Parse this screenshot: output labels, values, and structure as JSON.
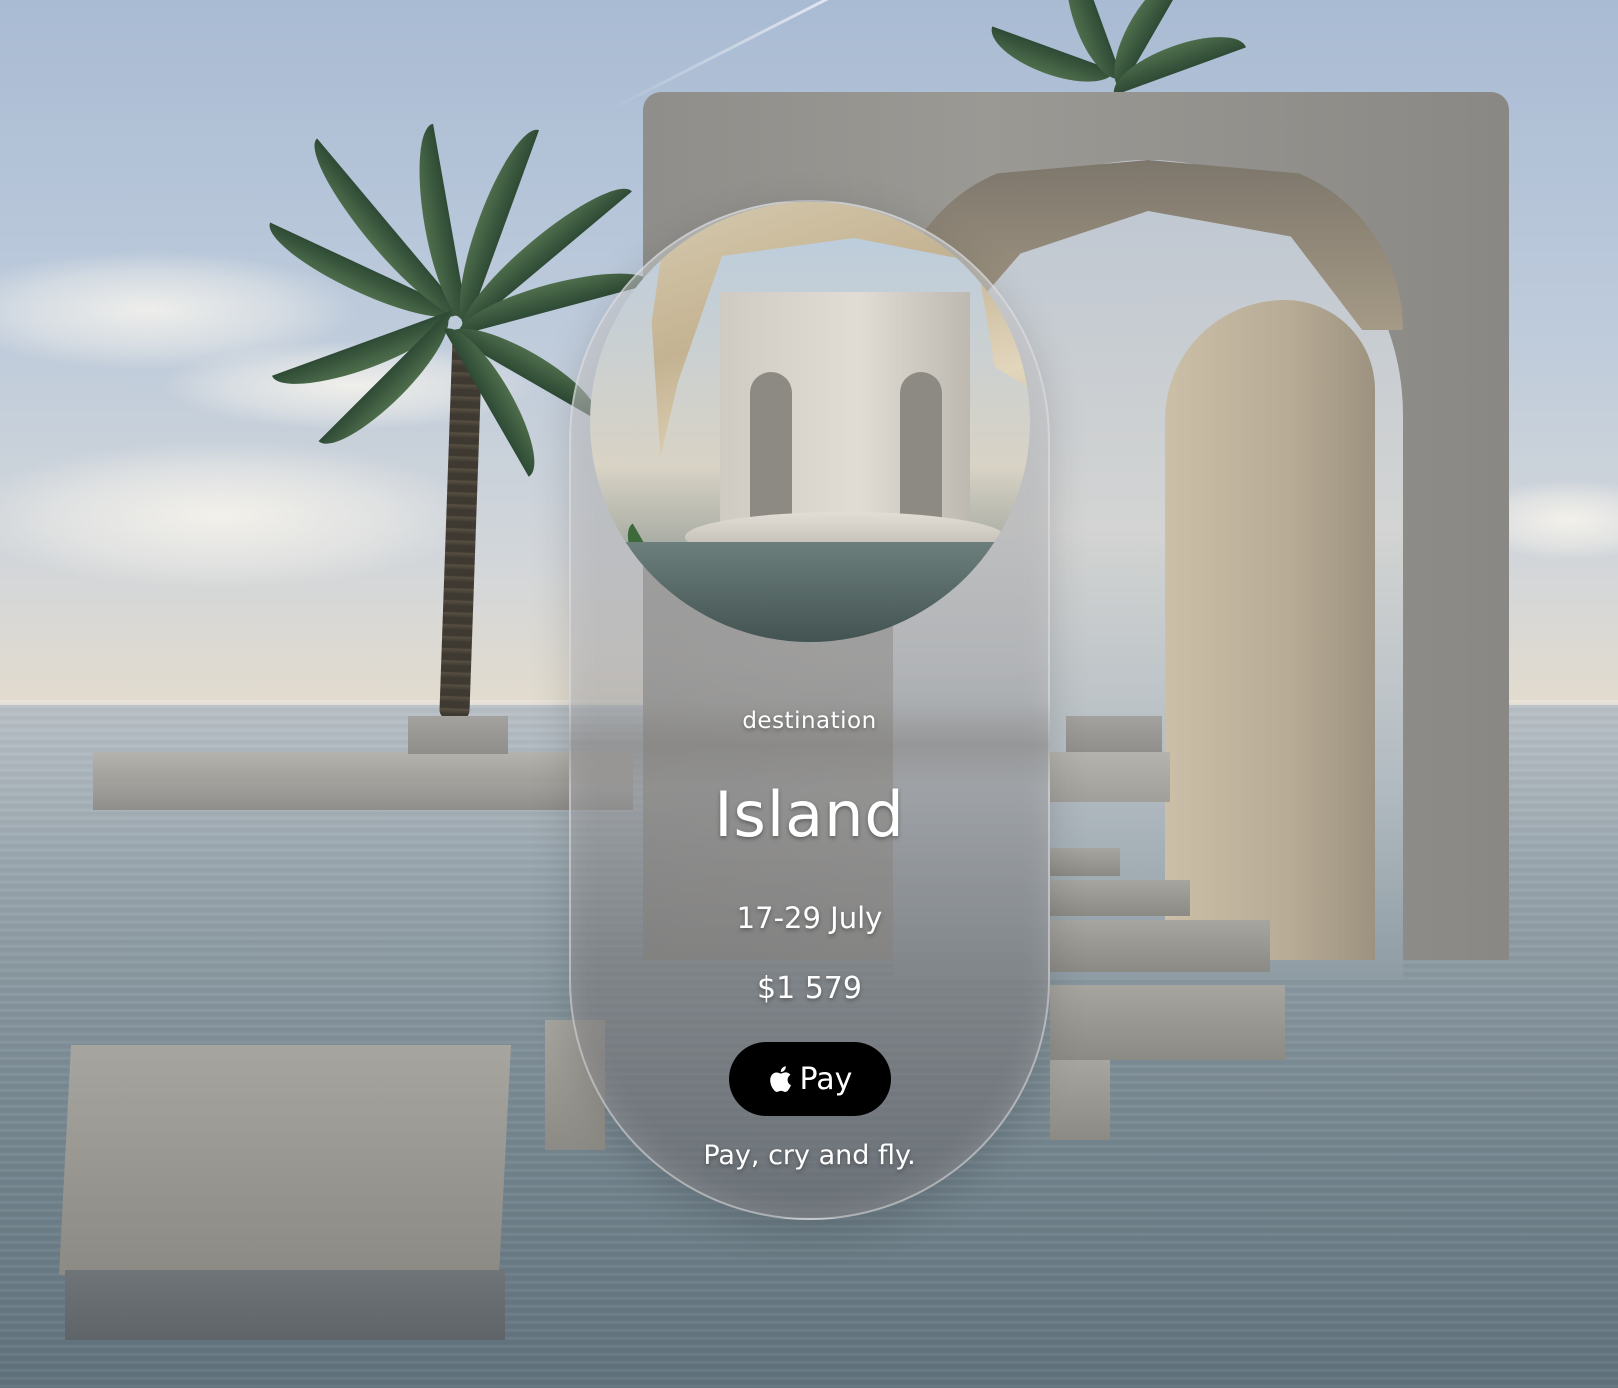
{
  "card": {
    "label": "destination",
    "title": "Island",
    "dates": "17-29 July",
    "price": "$1 579",
    "pay_button_label": "Pay",
    "pay_button_icon": "apple-logo-icon",
    "tagline": "Pay, cry and fly."
  },
  "colors": {
    "button_background": "#000000",
    "text": "#ffffff"
  }
}
